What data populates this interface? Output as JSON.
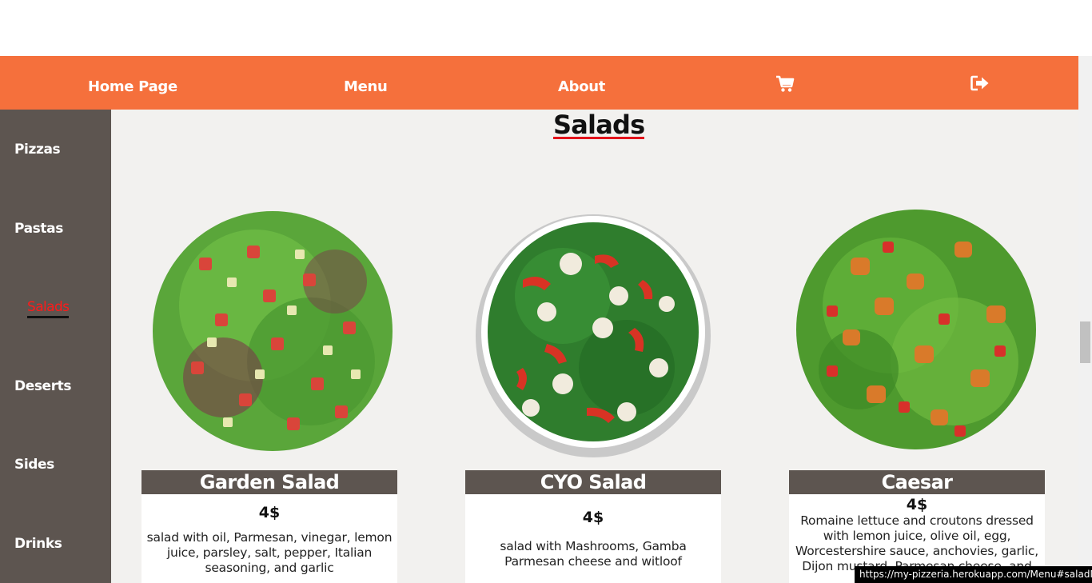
{
  "navbar": {
    "items": [
      {
        "label": "Home Page"
      },
      {
        "label": "Menu"
      },
      {
        "label": "About"
      }
    ],
    "cart_icon": "shopping-cart-icon",
    "logout_icon": "sign-out-icon",
    "background": "#f5703c"
  },
  "sidebar": {
    "items": [
      {
        "label": "Pizzas"
      },
      {
        "label": "Pastas"
      },
      {
        "label": "Salads",
        "active": true
      },
      {
        "label": "Deserts"
      },
      {
        "label": "Sides"
      },
      {
        "label": "Drinks"
      }
    ],
    "background": "#5d5550",
    "active_color": "#ff1a1a"
  },
  "main": {
    "title": "Salads",
    "cards": [
      {
        "name": "Garden Salad",
        "price": "4$",
        "description": "salad with oil, Parmesan, vinegar, lemon juice, parsley, salt, pepper, Italian seasoning, and garlic"
      },
      {
        "name": "CYO Salad",
        "price": "4$",
        "description": "salad with Mashrooms, Gamba Parmesan cheese and witloof"
      },
      {
        "name": "Caesar",
        "price": "4$",
        "description": "Romaine lettuce and croutons dressed with lemon juice, olive oil, egg, Worcestershire sauce, anchovies, garlic, Dijon mustard, Parmesan cheese, and black pepper"
      }
    ]
  },
  "status_bar": {
    "url": "https://my-pizzeria.herokuapp.com/Menu#saladMenu"
  }
}
